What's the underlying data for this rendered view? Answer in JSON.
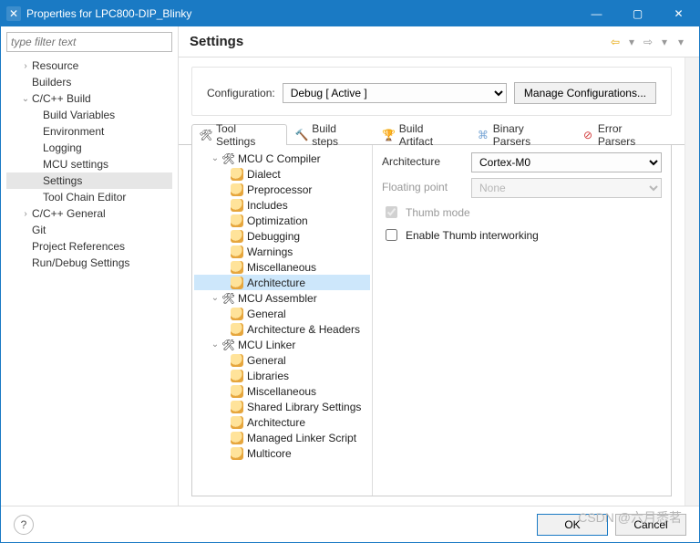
{
  "window": {
    "title": "Properties for LPC800-DIP_Blinky"
  },
  "filter_placeholder": "type filter text",
  "nav": {
    "resource": "Resource",
    "builders": "Builders",
    "cbuild": "C/C++ Build",
    "cbuild_items": {
      "build_vars": "Build Variables",
      "environment": "Environment",
      "logging": "Logging",
      "mcu_settings": "MCU settings",
      "settings": "Settings",
      "tool_chain_editor": "Tool Chain Editor"
    },
    "cgeneral": "C/C++ General",
    "git": "Git",
    "project_refs": "Project References",
    "run_debug": "Run/Debug Settings"
  },
  "header": {
    "title": "Settings"
  },
  "config": {
    "label": "Configuration:",
    "value": "Debug  [ Active ]",
    "manage": "Manage Configurations..."
  },
  "tabs": {
    "tool_settings": "Tool Settings",
    "build_steps": "Build steps",
    "build_artifact": "Build Artifact",
    "binary_parsers": "Binary Parsers",
    "error_parsers": "Error Parsers"
  },
  "tool_tree": {
    "compiler": "MCU C Compiler",
    "compiler_items": [
      "Dialect",
      "Preprocessor",
      "Includes",
      "Optimization",
      "Debugging",
      "Warnings",
      "Miscellaneous",
      "Architecture"
    ],
    "assembler": "MCU Assembler",
    "assembler_items": [
      "General",
      "Architecture & Headers"
    ],
    "linker": "MCU Linker",
    "linker_items": [
      "General",
      "Libraries",
      "Miscellaneous",
      "Shared Library Settings",
      "Architecture",
      "Managed Linker Script",
      "Multicore"
    ]
  },
  "form": {
    "arch_label": "Architecture",
    "arch_value": "Cortex-M0",
    "fp_label": "Floating point",
    "fp_value": "None",
    "thumb_mode": "Thumb mode",
    "thumb_interwork": "Enable Thumb interworking"
  },
  "footer": {
    "ok": "OK",
    "cancel": "Cancel"
  },
  "watermark": "CSDN @六月悉茗"
}
